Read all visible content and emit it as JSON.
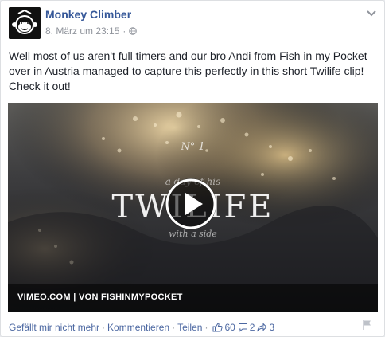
{
  "post": {
    "author": "Monkey Climber",
    "timestamp": "8. März um 23:15",
    "separator": "·",
    "text": "Well most of us aren't full timers and our bro Andi from Fish in my Pocket over in Austria managed to capture this perfectly in this short Twilife clip! Check it out!"
  },
  "video": {
    "overlay_number": "N° 1",
    "overlay_subtitle": "a day of his",
    "overlay_title": "TWILIFE",
    "overlay_with": "with a side",
    "source_bar": "VIMEO.COM  |  VON FISHINMYPOCKET"
  },
  "actions": {
    "unlike": "Gefällt mir nicht mehr",
    "comment": "Kommentieren",
    "share": "Teilen",
    "dot": "·",
    "likes": "60",
    "comments": "2",
    "shares": "3"
  },
  "colors": {
    "link": "#365899",
    "muted": "#90949c",
    "text": "#1d2129"
  },
  "icons": [
    "avatar-monkey",
    "globe-icon",
    "chevron-down-icon",
    "play-icon",
    "like-icon",
    "comment-icon",
    "share-icon",
    "flag-icon"
  ]
}
